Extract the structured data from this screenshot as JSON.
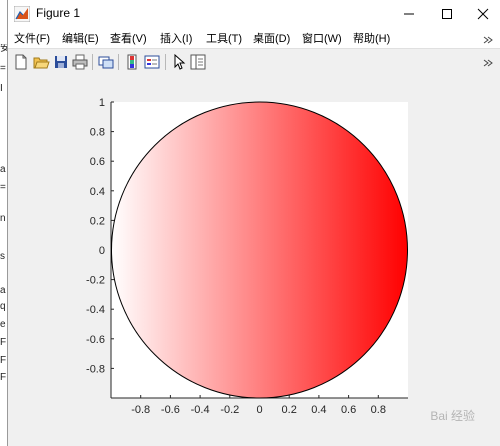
{
  "window": {
    "title": "Figure 1",
    "icon": "matlab-figure-icon",
    "controls": [
      "minimize-icon",
      "maximize-icon",
      "close-icon"
    ]
  },
  "menu": {
    "items": [
      {
        "label": "文件(F)"
      },
      {
        "label": "编辑(E)"
      },
      {
        "label": "查看(V)"
      },
      {
        "label": "插入(I)"
      },
      {
        "label": "工具(T)"
      },
      {
        "label": "桌面(D)"
      },
      {
        "label": "窗口(W)"
      },
      {
        "label": "帮助(H)"
      }
    ]
  },
  "toolbar": {
    "buttons": [
      {
        "icon": "new-figure-icon"
      },
      {
        "icon": "open-file-icon"
      },
      {
        "icon": "save-icon"
      },
      {
        "icon": "print-icon"
      },
      {
        "icon": "link-plot-icon"
      },
      {
        "icon": "insert-colorbar-icon"
      },
      {
        "icon": "insert-legend-icon"
      },
      {
        "icon": "edit-plot-pointer-icon"
      },
      {
        "icon": "property-inspector-icon"
      }
    ]
  },
  "background_app": {
    "left_strip_chars": [
      "安",
      "=",
      "I",
      "a",
      "=",
      "n",
      "s",
      "a",
      "q",
      "e",
      "F",
      "F",
      "F"
    ]
  },
  "chart_data": {
    "type": "area",
    "shape": "filled circle",
    "center": [
      0,
      0
    ],
    "radius": 1,
    "fill_gradient": {
      "from": "#ffffff",
      "to": "#ff0000",
      "direction": "left-to-right"
    },
    "edge_color": "#000000",
    "xlim": [
      -1,
      1
    ],
    "ylim": [
      -1,
      1
    ],
    "xticks": [
      "-0.8",
      "-0.6",
      "-0.4",
      "-0.2",
      "0",
      "0.2",
      "0.4",
      "0.6",
      "0.8"
    ],
    "yticks": [
      "1",
      "0.8",
      "0.6",
      "0.4",
      "0.2",
      "0",
      "-0.2",
      "-0.4",
      "-0.6",
      "-0.8"
    ],
    "xtick_values": [
      -0.8,
      -0.6,
      -0.4,
      -0.2,
      0,
      0.2,
      0.4,
      0.6,
      0.8
    ],
    "ytick_values": [
      1,
      0.8,
      0.6,
      0.4,
      0.2,
      0,
      -0.2,
      -0.4,
      -0.6,
      -0.8
    ],
    "grid": false
  },
  "watermark": {
    "text": "Bai 经验"
  }
}
